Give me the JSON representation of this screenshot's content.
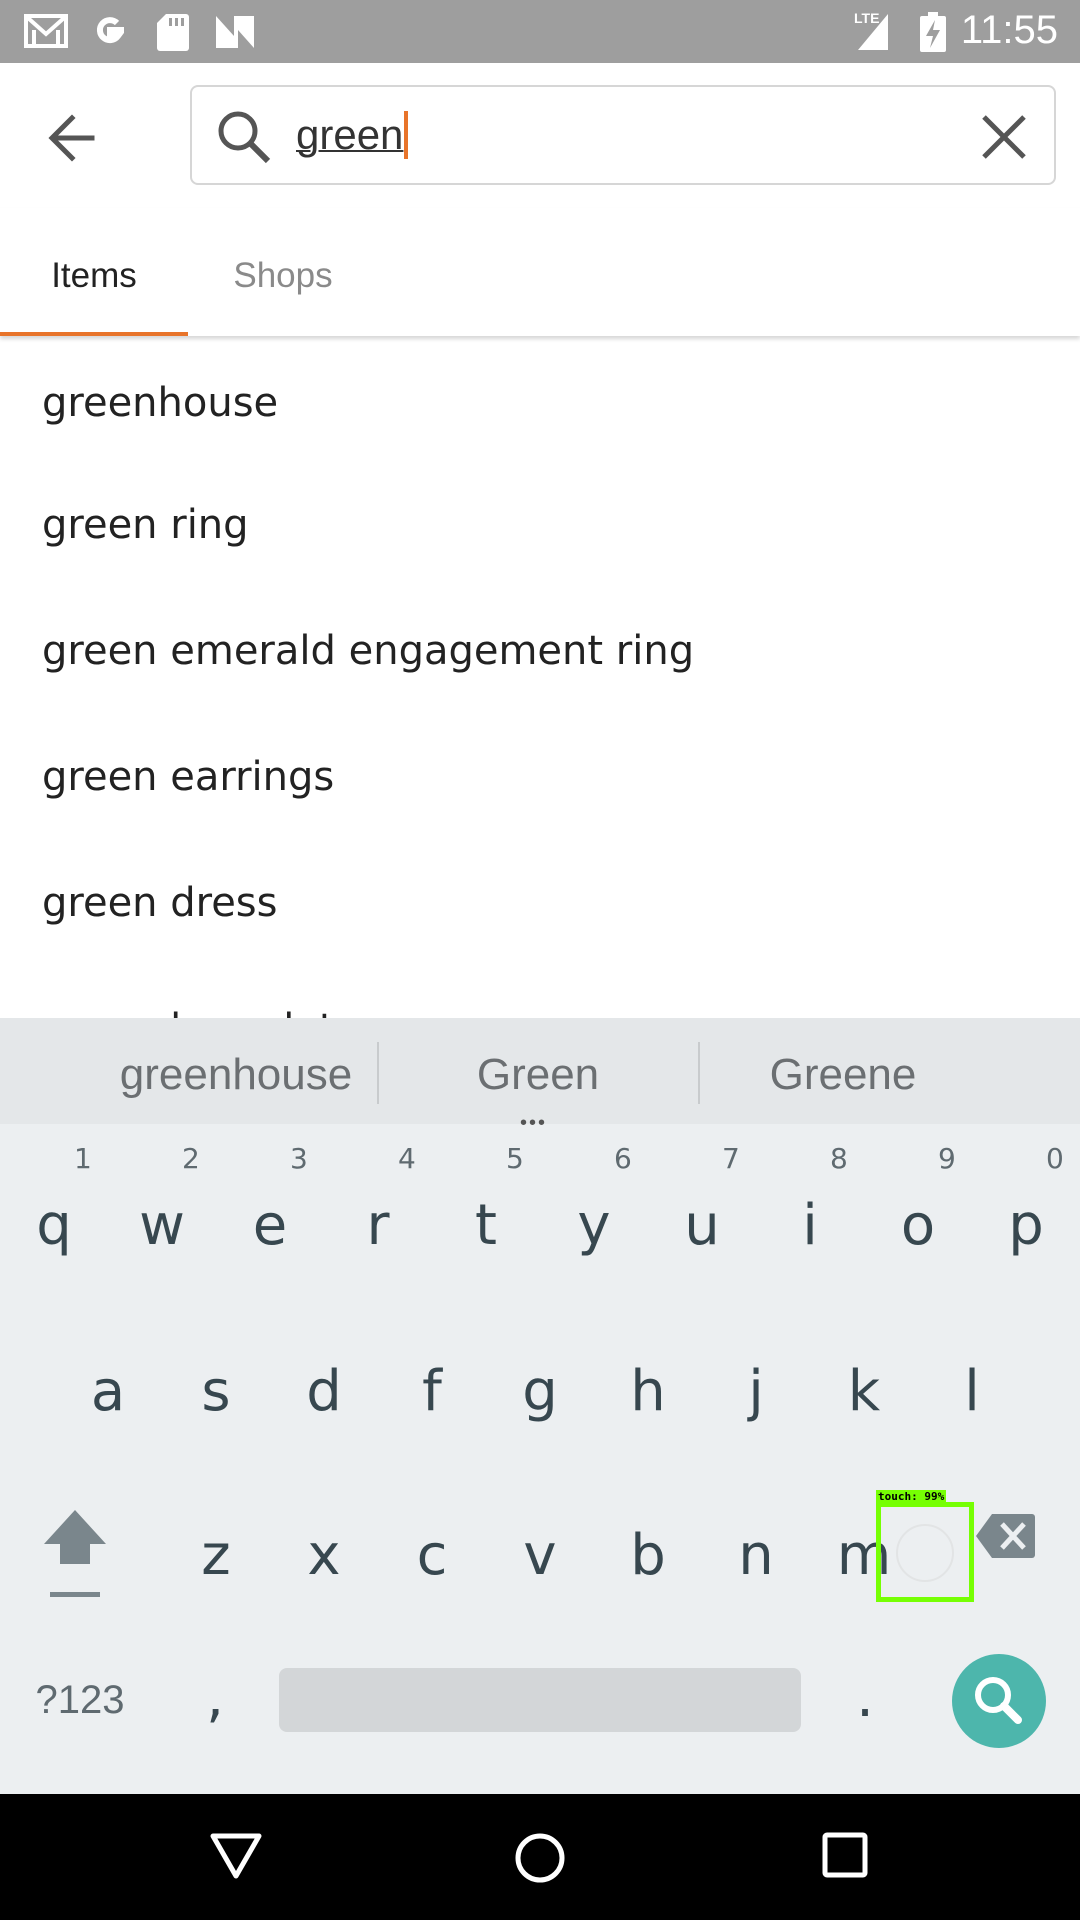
{
  "status_bar": {
    "time": "11:55",
    "network": "LTE",
    "icons": [
      "gmail-icon",
      "google-icon",
      "sd-card-icon",
      "n-icon",
      "signal-icon",
      "battery-charging-icon"
    ]
  },
  "search": {
    "value": "green",
    "back_icon": "arrow-back-icon",
    "search_icon": "search-icon",
    "clear_icon": "close-icon",
    "accent_color": "#e8742a"
  },
  "tabs": [
    {
      "label": "Items",
      "active": true
    },
    {
      "label": "Shops",
      "active": false
    }
  ],
  "suggestions": [
    "greenhouse",
    "green ring",
    "green emerald engagement ring",
    "green earrings",
    "green dress",
    "green bracelet"
  ],
  "keyboard": {
    "suggestions": [
      "greenhouse",
      "Green",
      "Greene"
    ],
    "row1": [
      {
        "letter": "q",
        "num": "1"
      },
      {
        "letter": "w",
        "num": "2"
      },
      {
        "letter": "e",
        "num": "3"
      },
      {
        "letter": "r",
        "num": "4"
      },
      {
        "letter": "t",
        "num": "5"
      },
      {
        "letter": "y",
        "num": "6"
      },
      {
        "letter": "u",
        "num": "7"
      },
      {
        "letter": "i",
        "num": "8"
      },
      {
        "letter": "o",
        "num": "9"
      },
      {
        "letter": "p",
        "num": "0"
      }
    ],
    "row2": [
      "a",
      "s",
      "d",
      "f",
      "g",
      "h",
      "j",
      "k",
      "l"
    ],
    "row3": [
      "z",
      "x",
      "c",
      "v",
      "b",
      "n",
      "m"
    ],
    "symbols_label": "?123",
    "comma": ",",
    "period": ".",
    "action_color": "#4db6ac"
  },
  "touch_overlay": {
    "label": "touch: 99%",
    "color": "#76ff03"
  },
  "nav_bar": {
    "icons": [
      "back-triangle-icon",
      "home-circle-icon",
      "recents-square-icon"
    ]
  }
}
